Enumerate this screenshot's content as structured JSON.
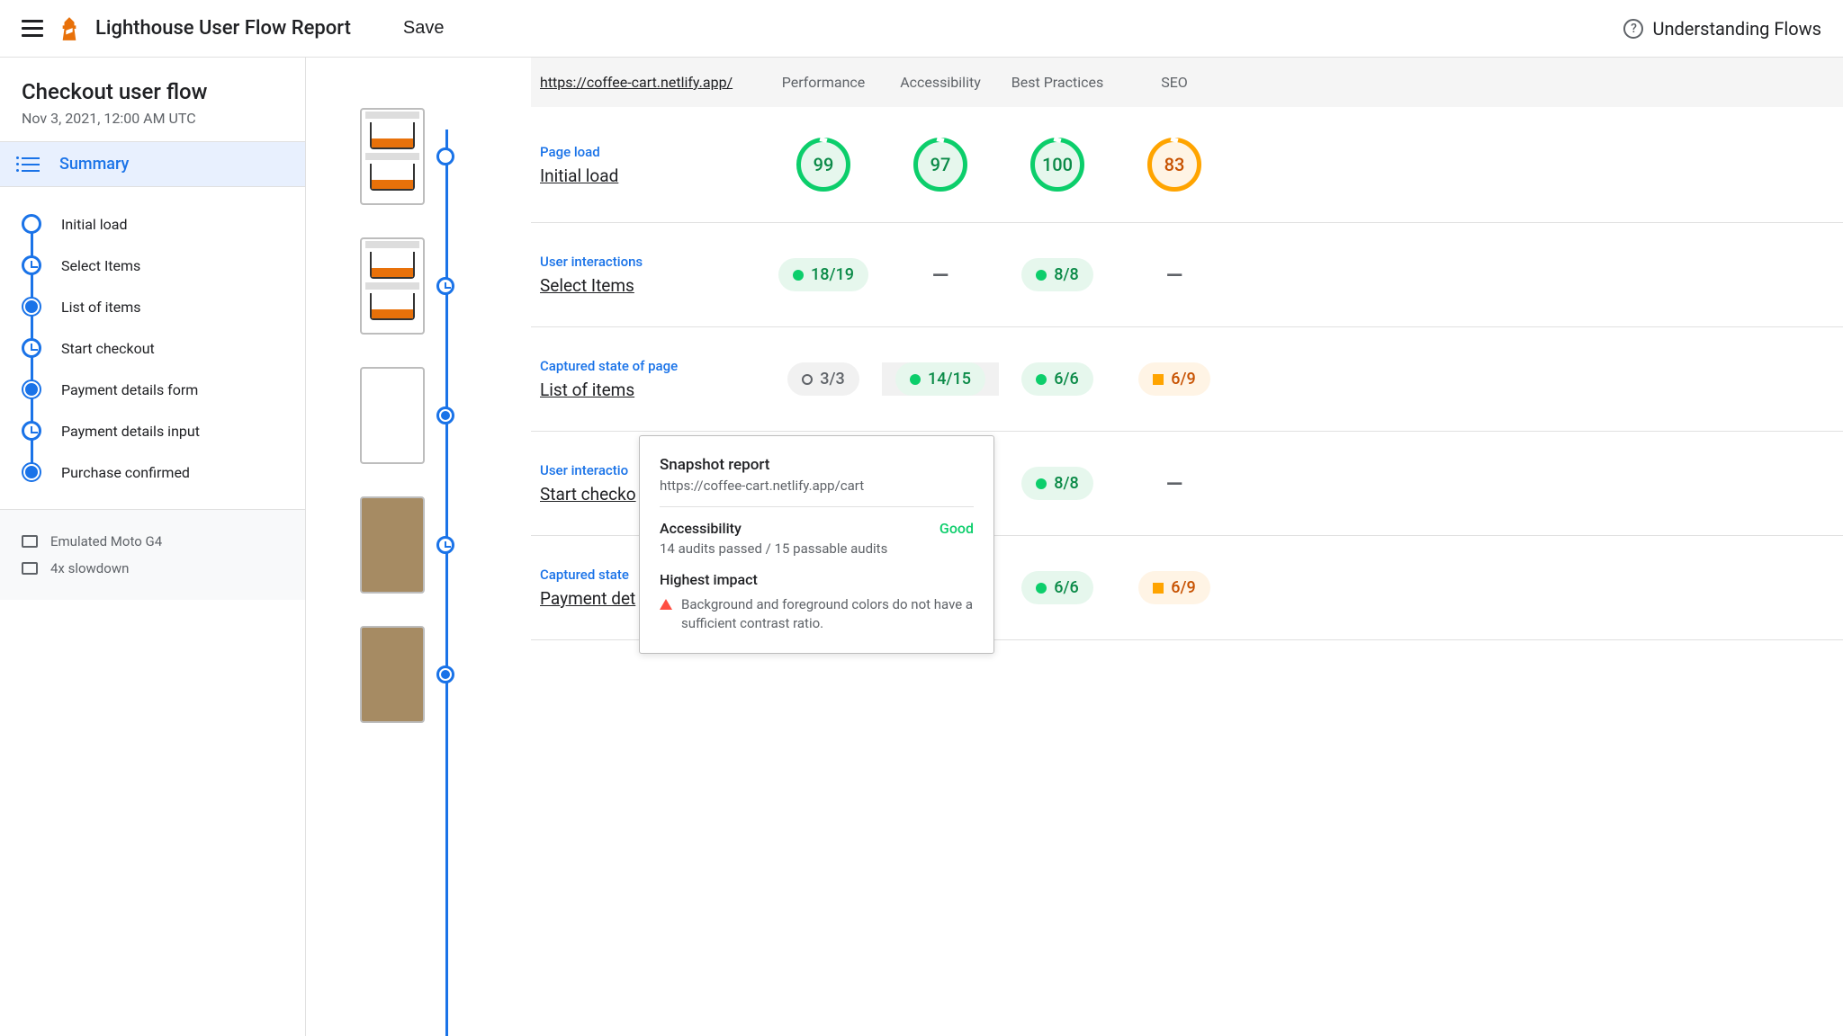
{
  "header": {
    "app_title": "Lighthouse User Flow Report",
    "save_label": "Save",
    "help_label": "Understanding Flows"
  },
  "sidebar": {
    "flow_title": "Checkout user flow",
    "flow_date": "Nov 3, 2021, 12:00 AM UTC",
    "summary_label": "Summary",
    "nav": [
      {
        "label": "Initial load",
        "marker": "circle"
      },
      {
        "label": "Select Items",
        "marker": "clock"
      },
      {
        "label": "List of items",
        "marker": "aperture"
      },
      {
        "label": "Start checkout",
        "marker": "clock"
      },
      {
        "label": "Payment details form",
        "marker": "aperture"
      },
      {
        "label": "Payment details input",
        "marker": "clock"
      },
      {
        "label": "Purchase confirmed",
        "marker": "aperture"
      }
    ],
    "meta": {
      "device": "Emulated Moto G4",
      "throttle": "4x slowdown"
    }
  },
  "table": {
    "url": "https://coffee-cart.netlify.app/",
    "categories": [
      "Performance",
      "Accessibility",
      "Best Practices",
      "SEO"
    ],
    "rows": [
      {
        "type": "Page load",
        "name": "Initial load",
        "cells": [
          {
            "kind": "gauge",
            "value": "99",
            "style": "green"
          },
          {
            "kind": "gauge",
            "value": "97",
            "style": "green"
          },
          {
            "kind": "gauge",
            "value": "100",
            "style": "green"
          },
          {
            "kind": "gauge",
            "value": "83",
            "style": "orange"
          }
        ]
      },
      {
        "type": "User interactions",
        "name": "Select Items",
        "cells": [
          {
            "kind": "badge",
            "value": "18/19",
            "style": "green"
          },
          {
            "kind": "dash"
          },
          {
            "kind": "badge",
            "value": "8/8",
            "style": "green"
          },
          {
            "kind": "dash"
          }
        ]
      },
      {
        "type": "Captured state of page",
        "name": "List of items",
        "cells": [
          {
            "kind": "badge",
            "value": "3/3",
            "style": "gray"
          },
          {
            "kind": "badge",
            "value": "14/15",
            "style": "green",
            "highlight": true
          },
          {
            "kind": "badge",
            "value": "6/6",
            "style": "green"
          },
          {
            "kind": "badge",
            "value": "6/9",
            "style": "orange"
          }
        ]
      },
      {
        "type": "User interactions",
        "name": "Start checkout",
        "truncated_type": "User interactio",
        "truncated_name": "Start checko",
        "cells": [
          {
            "kind": "hidden"
          },
          {
            "kind": "hidden"
          },
          {
            "kind": "badge",
            "value": "8/8",
            "style": "green"
          },
          {
            "kind": "dash"
          }
        ]
      },
      {
        "type": "Captured state of page",
        "name": "Payment details form",
        "truncated_type": "Captured state",
        "truncated_name": "Payment det",
        "cells": [
          {
            "kind": "hidden"
          },
          {
            "kind": "hidden"
          },
          {
            "kind": "badge",
            "value": "6/6",
            "style": "green"
          },
          {
            "kind": "badge",
            "value": "6/9",
            "style": "orange"
          }
        ]
      }
    ]
  },
  "tooltip": {
    "title": "Snapshot report",
    "url": "https://coffee-cart.netlify.app/cart",
    "category": "Accessibility",
    "status": "Good",
    "detail": "14 audits passed / 15 passable audits",
    "impact_title": "Highest impact",
    "impact_text": "Background and foreground colors do not have a sufficient contrast ratio."
  },
  "timeline_markers": [
    "circle",
    "clock",
    "aperture",
    "clock",
    "aperture"
  ]
}
